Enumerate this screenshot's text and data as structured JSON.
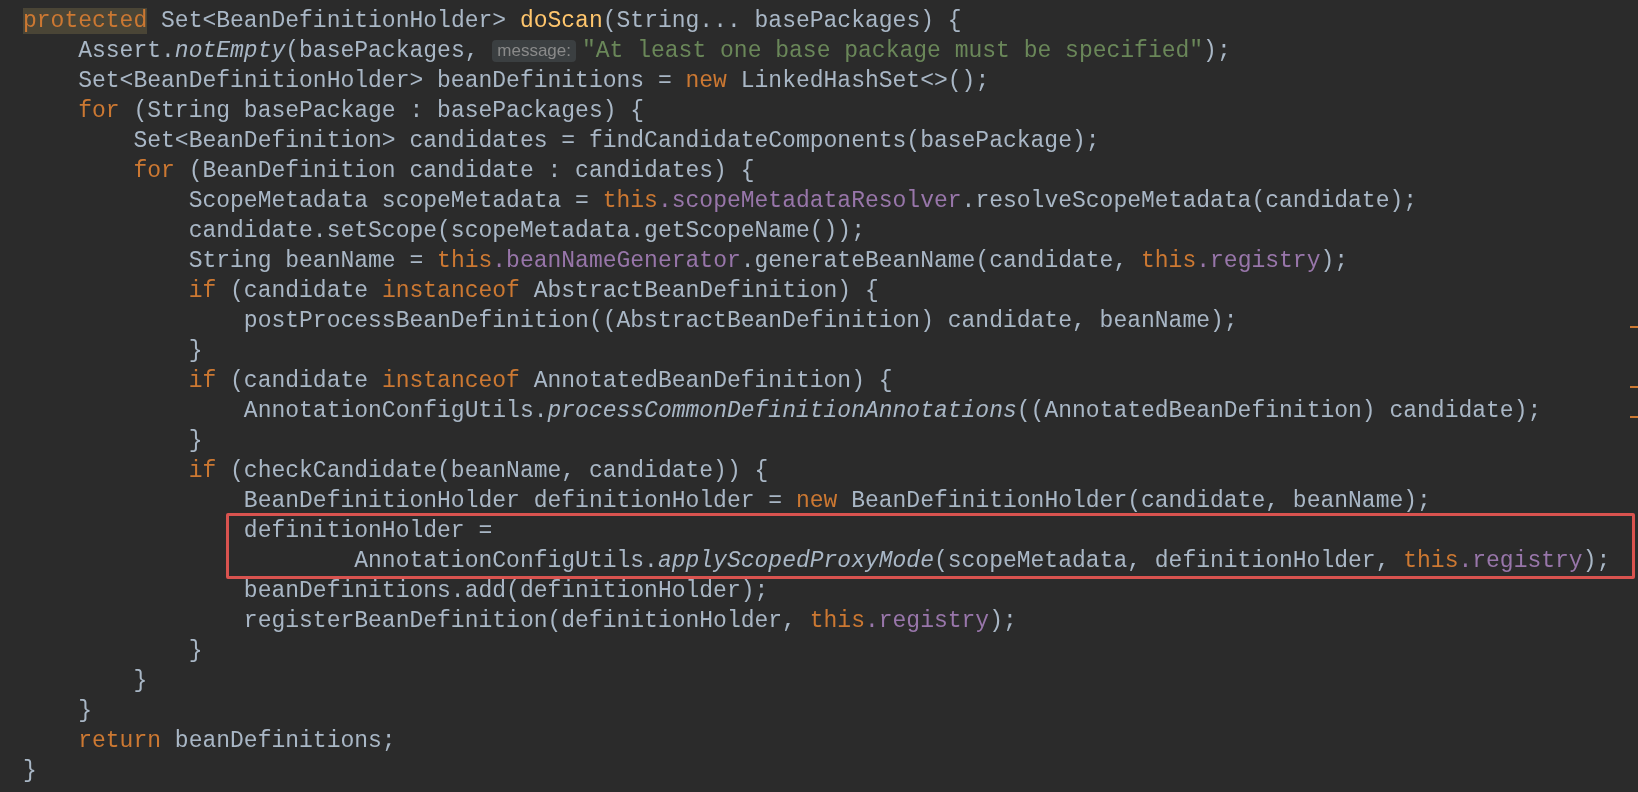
{
  "editor": {
    "lines": [
      {
        "boxed": false,
        "marker": false,
        "tokens": [
          {
            "kind": "keyword_hl",
            "text": "protected"
          },
          {
            "kind": "plain",
            "text": " Set<BeanDefinitionHolder> "
          },
          {
            "kind": "method_decl",
            "text": "doScan"
          },
          {
            "kind": "plain",
            "text": "(String... basePackages) {"
          }
        ]
      },
      {
        "boxed": false,
        "marker": false,
        "tokens": [
          {
            "kind": "plain",
            "text": "    Assert."
          },
          {
            "kind": "static_call",
            "text": "notEmpty"
          },
          {
            "kind": "plain",
            "text": "(basePackages, "
          },
          {
            "kind": "hint",
            "text": "message:"
          },
          {
            "kind": "string",
            "text": "\"At least one base package must be specified\""
          },
          {
            "kind": "plain",
            "text": ");"
          }
        ]
      },
      {
        "boxed": false,
        "marker": false,
        "tokens": [
          {
            "kind": "plain",
            "text": "    Set<BeanDefinitionHolder> beanDefinitions = "
          },
          {
            "kind": "keyword",
            "text": "new"
          },
          {
            "kind": "plain",
            "text": " LinkedHashSet<>();"
          }
        ]
      },
      {
        "boxed": false,
        "marker": false,
        "tokens": [
          {
            "kind": "keyword",
            "text": "    for"
          },
          {
            "kind": "plain",
            "text": " (String basePackage : basePackages) {"
          }
        ]
      },
      {
        "boxed": false,
        "marker": false,
        "tokens": [
          {
            "kind": "plain",
            "text": "        Set<BeanDefinition> candidates = findCandidateComponents(basePackage);"
          }
        ]
      },
      {
        "boxed": false,
        "marker": false,
        "tokens": [
          {
            "kind": "keyword",
            "text": "        for"
          },
          {
            "kind": "plain",
            "text": " (BeanDefinition candidate : candidates) {"
          }
        ]
      },
      {
        "boxed": false,
        "marker": false,
        "tokens": [
          {
            "kind": "plain",
            "text": "            ScopeMetadata scopeMetadata = "
          },
          {
            "kind": "keyword",
            "text": "this"
          },
          {
            "kind": "field",
            "text": ".scopeMetadataResolver"
          },
          {
            "kind": "plain",
            "text": ".resolveScopeMetadata(candidate);"
          }
        ]
      },
      {
        "boxed": false,
        "marker": false,
        "tokens": [
          {
            "kind": "plain",
            "text": "            candidate.setScope(scopeMetadata.getScopeName());"
          }
        ]
      },
      {
        "boxed": false,
        "marker": false,
        "tokens": [
          {
            "kind": "plain",
            "text": "            String beanName = "
          },
          {
            "kind": "keyword",
            "text": "this"
          },
          {
            "kind": "field",
            "text": ".beanNameGenerator"
          },
          {
            "kind": "plain",
            "text": ".generateBeanName(candidate, "
          },
          {
            "kind": "keyword",
            "text": "this"
          },
          {
            "kind": "field",
            "text": ".registry"
          },
          {
            "kind": "plain",
            "text": ");"
          }
        ]
      },
      {
        "boxed": false,
        "marker": false,
        "tokens": [
          {
            "kind": "keyword",
            "text": "            if"
          },
          {
            "kind": "plain",
            "text": " (candidate "
          },
          {
            "kind": "keyword",
            "text": "instanceof"
          },
          {
            "kind": "plain",
            "text": " AbstractBeanDefinition) {"
          }
        ]
      },
      {
        "boxed": false,
        "marker": true,
        "tokens": [
          {
            "kind": "plain",
            "text": "                postProcessBeanDefinition((AbstractBeanDefinition) candidate, beanName);"
          }
        ]
      },
      {
        "boxed": false,
        "marker": false,
        "tokens": [
          {
            "kind": "plain",
            "text": "            }"
          }
        ]
      },
      {
        "boxed": false,
        "marker": true,
        "tokens": [
          {
            "kind": "keyword",
            "text": "            if"
          },
          {
            "kind": "plain",
            "text": " (candidate "
          },
          {
            "kind": "keyword",
            "text": "instanceof"
          },
          {
            "kind": "plain",
            "text": " AnnotatedBeanDefinition) {"
          }
        ]
      },
      {
        "boxed": false,
        "marker": true,
        "tokens": [
          {
            "kind": "plain",
            "text": "                AnnotationConfigUtils."
          },
          {
            "kind": "static_call",
            "text": "processCommonDefinitionAnnotations"
          },
          {
            "kind": "plain",
            "text": "((AnnotatedBeanDefinition) candidate);"
          }
        ]
      },
      {
        "boxed": false,
        "marker": false,
        "tokens": [
          {
            "kind": "plain",
            "text": "            }"
          }
        ]
      },
      {
        "boxed": false,
        "marker": false,
        "tokens": [
          {
            "kind": "keyword",
            "text": "            if"
          },
          {
            "kind": "plain",
            "text": " (checkCandidate(beanName, candidate)) {"
          }
        ]
      },
      {
        "boxed": false,
        "marker": false,
        "tokens": [
          {
            "kind": "plain",
            "text": "                BeanDefinitionHolder definitionHolder = "
          },
          {
            "kind": "keyword",
            "text": "new"
          },
          {
            "kind": "plain",
            "text": " BeanDefinitionHolder(candidate, beanName);"
          }
        ]
      },
      {
        "boxed": true,
        "marker": false,
        "tokens": [
          {
            "kind": "plain",
            "text": "                definitionHolder ="
          }
        ]
      },
      {
        "boxed": true,
        "marker": false,
        "tokens": [
          {
            "kind": "plain",
            "text": "                        AnnotationConfigUtils."
          },
          {
            "kind": "static_call",
            "text": "applyScopedProxyMode"
          },
          {
            "kind": "plain",
            "text": "(scopeMetadata, definitionHolder, "
          },
          {
            "kind": "keyword",
            "text": "this"
          },
          {
            "kind": "field",
            "text": ".registry"
          },
          {
            "kind": "plain",
            "text": ");"
          }
        ]
      },
      {
        "boxed": false,
        "marker": false,
        "tokens": [
          {
            "kind": "plain",
            "text": "                beanDefinitions.add(definitionHolder);"
          }
        ]
      },
      {
        "boxed": false,
        "marker": false,
        "tokens": [
          {
            "kind": "plain",
            "text": "                registerBeanDefinition(definitionHolder, "
          },
          {
            "kind": "keyword",
            "text": "this"
          },
          {
            "kind": "field",
            "text": ".registry"
          },
          {
            "kind": "plain",
            "text": ");"
          }
        ]
      },
      {
        "boxed": false,
        "marker": false,
        "tokens": [
          {
            "kind": "plain",
            "text": "            }"
          }
        ]
      },
      {
        "boxed": false,
        "marker": false,
        "tokens": [
          {
            "kind": "plain",
            "text": "        }"
          }
        ]
      },
      {
        "boxed": false,
        "marker": false,
        "tokens": [
          {
            "kind": "plain",
            "text": "    }"
          }
        ]
      },
      {
        "boxed": false,
        "marker": false,
        "tokens": [
          {
            "kind": "keyword",
            "text": "    return"
          },
          {
            "kind": "plain",
            "text": " beanDefinitions;"
          }
        ]
      },
      {
        "boxed": false,
        "marker": false,
        "tokens": [
          {
            "kind": "plain",
            "text": "}"
          }
        ]
      }
    ]
  }
}
